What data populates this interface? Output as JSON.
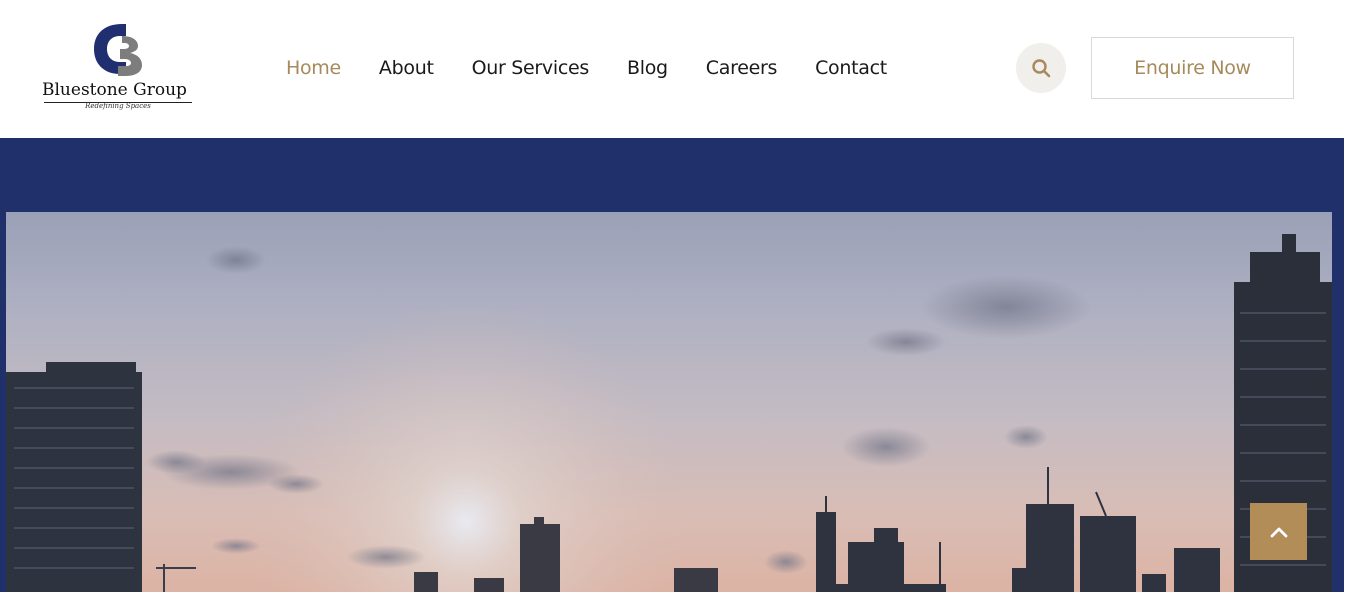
{
  "brand": {
    "name": "Bluestone Group",
    "tagline": "Redefining Spaces"
  },
  "nav": {
    "items": [
      {
        "label": "Home",
        "active": true
      },
      {
        "label": "About",
        "active": false
      },
      {
        "label": "Our Services",
        "active": false
      },
      {
        "label": "Blog",
        "active": false
      },
      {
        "label": "Careers",
        "active": false
      },
      {
        "label": "Contact",
        "active": false
      }
    ]
  },
  "header": {
    "search_icon": "search-icon",
    "cta_label": "Enquire Now"
  },
  "hero": {
    "image_alt": "City skyline at sunset"
  },
  "scroll_top": {
    "icon": "chevron-up-icon"
  },
  "colors": {
    "accent": "#a78a5b",
    "band": "#20306b",
    "scroll_button": "#b28d57",
    "logo_blue": "#1f2f70",
    "logo_grey": "#7d7d7d"
  }
}
